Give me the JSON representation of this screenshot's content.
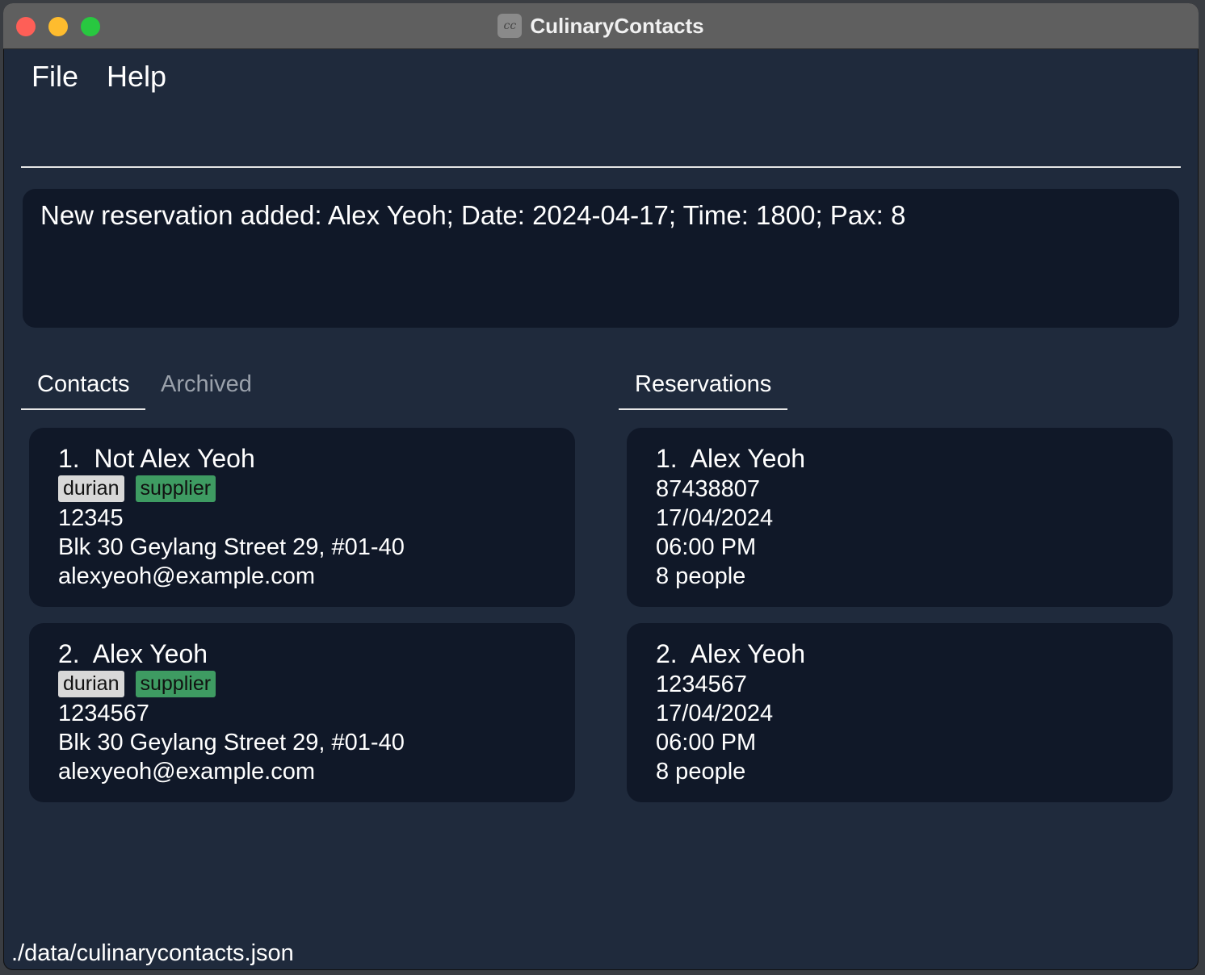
{
  "window": {
    "title": "CulinaryContacts",
    "icon_name": "app-logo-icon",
    "icon_glyph": "cc"
  },
  "menu": {
    "items": [
      "File",
      "Help"
    ]
  },
  "command": {
    "value": ""
  },
  "result": {
    "text": "New reservation added: Alex Yeoh; Date: 2024-04-17; Time: 1800; Pax: 8"
  },
  "contacts_tabs": [
    {
      "label": "Contacts",
      "active": true
    },
    {
      "label": "Archived",
      "active": false
    }
  ],
  "reservations_tab": {
    "label": "Reservations",
    "active": true
  },
  "contacts": [
    {
      "index": "1.",
      "name": "Not Alex Yeoh",
      "tags": [
        "durian",
        "supplier"
      ],
      "phone": "12345",
      "address": "Blk 30 Geylang Street 29, #01-40",
      "email": "alexyeoh@example.com"
    },
    {
      "index": "2.",
      "name": "Alex Yeoh",
      "tags": [
        "durian",
        "supplier"
      ],
      "phone": "1234567",
      "address": "Blk 30 Geylang Street 29, #01-40",
      "email": "alexyeoh@example.com"
    }
  ],
  "reservations": [
    {
      "index": "1.",
      "name": "Alex Yeoh",
      "phone": "87438807",
      "date": "17/04/2024",
      "time": "06:00 PM",
      "pax": "8 people"
    },
    {
      "index": "2.",
      "name": "Alex Yeoh",
      "phone": "1234567",
      "date": "17/04/2024",
      "time": "06:00 PM",
      "pax": "8 people"
    }
  ],
  "status_bar": {
    "path": "./data/culinarycontacts.json"
  },
  "colors": {
    "background": "#1f2a3c",
    "card": "#101828",
    "tag_durian": "#d8d8d8",
    "tag_supplier": "#3e9b62",
    "close": "#fe5f57",
    "minimize": "#febc2e",
    "maximize": "#28c840"
  }
}
